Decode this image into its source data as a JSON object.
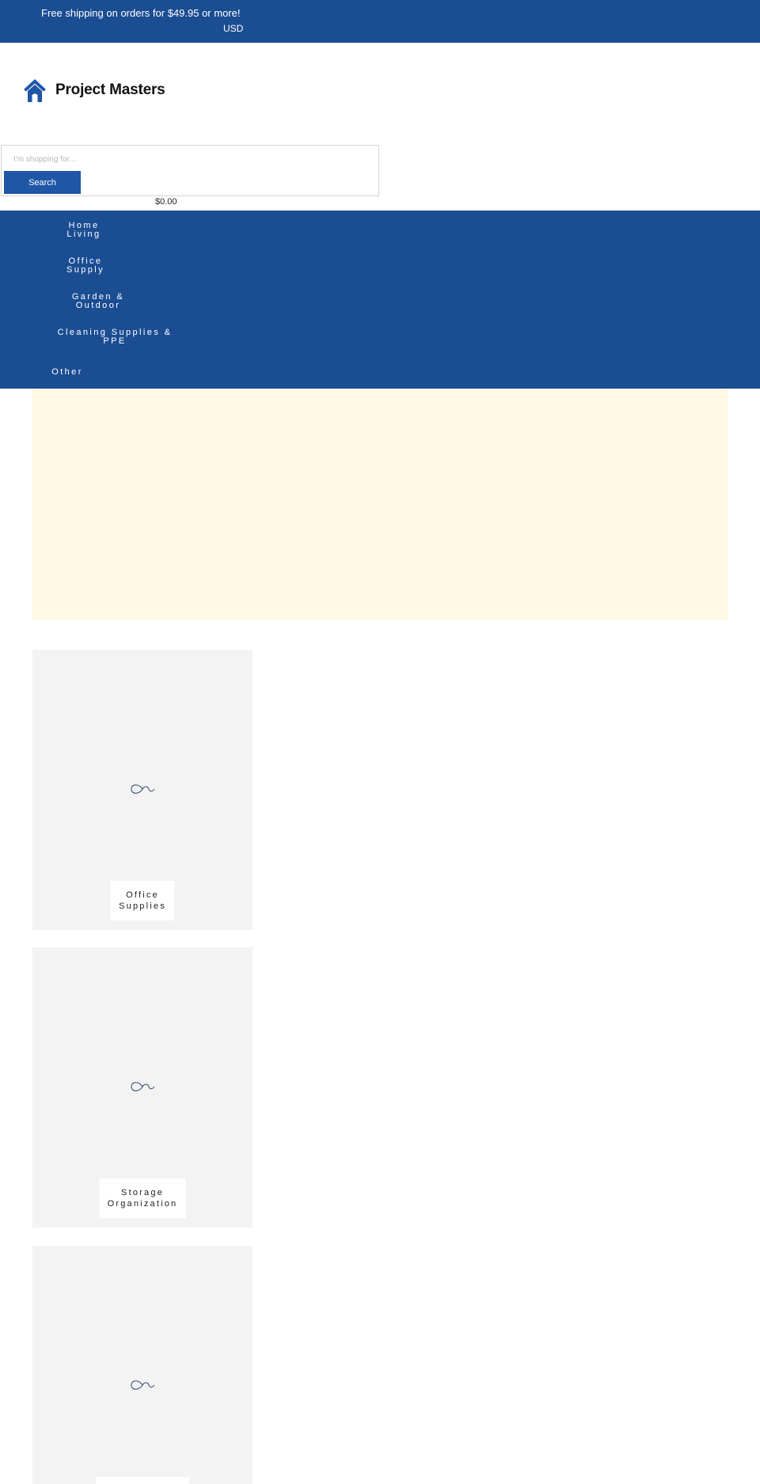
{
  "topbar": {
    "shipping_text": "Free shipping on orders for $49.95 or more!",
    "currency": "USD"
  },
  "brand": {
    "name": "Project Masters",
    "logo_icon": "house-icon",
    "logo_color": "#1f56a6"
  },
  "search": {
    "placeholder": "I'm shopping for....",
    "button_label": "Search"
  },
  "cart": {
    "total": "$0.00"
  },
  "nav": {
    "items": [
      {
        "line1": "Home",
        "line2": "Living"
      },
      {
        "line1": "Office",
        "line2": "Supply"
      },
      {
        "line1": "Garden &",
        "line2": "Outdoor"
      },
      {
        "line1": "Cleaning Supplies &",
        "line2": "PPE"
      },
      {
        "line1": "Other",
        "line2": ""
      }
    ]
  },
  "collections": [
    {
      "line1": "Office",
      "line2": "Supplies",
      "icon": "image-placeholder-icon"
    },
    {
      "line1": "Storage",
      "line2": "Organization",
      "icon": "image-placeholder-icon"
    },
    {
      "line1": "",
      "line2": "",
      "icon": "image-placeholder-icon"
    }
  ],
  "colors": {
    "primary": "#1b4d93",
    "button": "#1f56a6",
    "hero_background": "#fff8e4",
    "card_background": "#f3f3f3"
  }
}
